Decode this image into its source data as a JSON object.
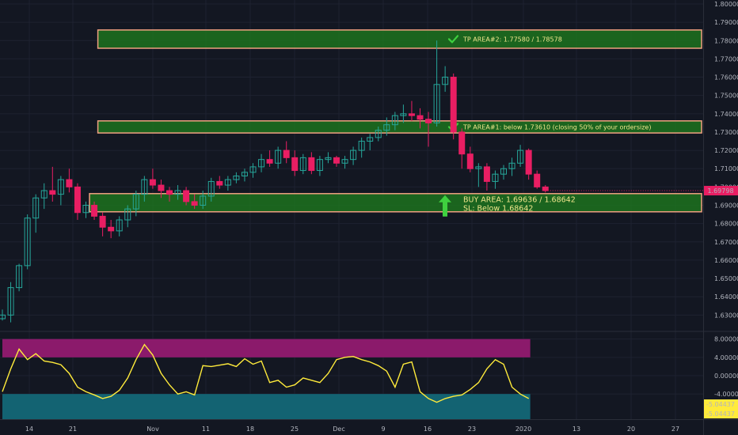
{
  "colors": {
    "background": "#131722",
    "grid": "#1e2230",
    "up": "#26a69a",
    "down": "#e91e63",
    "zone_fill": "#1e7a1e",
    "zone_border": "#f0a080",
    "osc_line": "#ffeb3b",
    "osc_upper_band": "#8b1a6b",
    "osc_lower_band": "#136372",
    "price_badge": "#e91e63",
    "label_text": "#f0e68c",
    "axis_text": "#b2b5be",
    "checkmark": "#3fd13f"
  },
  "icons": {
    "tp_check": "check-mark-icon",
    "buy_arrow": "arrow-up-icon"
  },
  "chart_data": [
    {
      "type": "candlestick",
      "x_ticks": [
        "14",
        "21",
        "Nov",
        "11",
        "18",
        "25",
        "Dec",
        "9",
        "16",
        "23",
        "2020",
        "13",
        "20",
        "27"
      ],
      "y_ticks": [
        "1.80000",
        "1.79000",
        "1.78000",
        "1.77000",
        "1.76000",
        "1.75000",
        "1.74000",
        "1.73000",
        "1.72000",
        "1.71000",
        "1.70000",
        "1.69000",
        "1.68000",
        "1.67000",
        "1.66000",
        "1.65000",
        "1.64000",
        "1.63000"
      ],
      "ylim": [
        1.6215,
        1.8
      ],
      "last_price": "1.69798",
      "candles": [
        [
          1.628,
          1.633,
          1.627,
          1.63
        ],
        [
          1.63,
          1.648,
          1.626,
          1.645
        ],
        [
          1.645,
          1.658,
          1.643,
          1.657
        ],
        [
          1.657,
          1.685,
          1.655,
          1.683
        ],
        [
          1.683,
          1.696,
          1.675,
          1.694
        ],
        [
          1.694,
          1.702,
          1.688,
          1.698
        ],
        [
          1.698,
          1.711,
          1.692,
          1.696
        ],
        [
          1.696,
          1.706,
          1.69,
          1.704
        ],
        [
          1.704,
          1.71,
          1.697,
          1.7
        ],
        [
          1.7,
          1.702,
          1.682,
          1.686
        ],
        [
          1.686,
          1.692,
          1.683,
          1.69
        ],
        [
          1.69,
          1.692,
          1.682,
          1.684
        ],
        [
          1.684,
          1.686,
          1.673,
          1.678
        ],
        [
          1.678,
          1.682,
          1.672,
          1.676
        ],
        [
          1.676,
          1.684,
          1.673,
          1.682
        ],
        [
          1.682,
          1.69,
          1.678,
          1.688
        ],
        [
          1.688,
          1.698,
          1.684,
          1.696
        ],
        [
          1.696,
          1.706,
          1.692,
          1.704
        ],
        [
          1.704,
          1.71,
          1.699,
          1.701
        ],
        [
          1.701,
          1.704,
          1.694,
          1.698
        ],
        [
          1.698,
          1.7,
          1.692,
          1.696
        ],
        [
          1.696,
          1.701,
          1.693,
          1.698
        ],
        [
          1.698,
          1.7,
          1.69,
          1.692
        ],
        [
          1.692,
          1.696,
          1.688,
          1.69
        ],
        [
          1.69,
          1.698,
          1.688,
          1.695
        ],
        [
          1.695,
          1.705,
          1.692,
          1.703
        ],
        [
          1.703,
          1.706,
          1.699,
          1.701
        ],
        [
          1.701,
          1.706,
          1.698,
          1.704
        ],
        [
          1.704,
          1.708,
          1.702,
          1.706
        ],
        [
          1.706,
          1.71,
          1.703,
          1.708
        ],
        [
          1.708,
          1.713,
          1.705,
          1.711
        ],
        [
          1.711,
          1.718,
          1.708,
          1.715
        ],
        [
          1.715,
          1.72,
          1.711,
          1.713
        ],
        [
          1.713,
          1.722,
          1.71,
          1.72
        ],
        [
          1.72,
          1.725,
          1.713,
          1.716
        ],
        [
          1.716,
          1.72,
          1.706,
          1.709
        ],
        [
          1.709,
          1.718,
          1.707,
          1.716
        ],
        [
          1.716,
          1.719,
          1.707,
          1.709
        ],
        [
          1.709,
          1.717,
          1.706,
          1.715
        ],
        [
          1.715,
          1.719,
          1.713,
          1.716
        ],
        [
          1.716,
          1.717,
          1.711,
          1.713
        ],
        [
          1.713,
          1.717,
          1.71,
          1.715
        ],
        [
          1.715,
          1.722,
          1.712,
          1.72
        ],
        [
          1.72,
          1.727,
          1.716,
          1.725
        ],
        [
          1.725,
          1.729,
          1.72,
          1.727
        ],
        [
          1.727,
          1.733,
          1.725,
          1.731
        ],
        [
          1.731,
          1.738,
          1.728,
          1.734
        ],
        [
          1.734,
          1.741,
          1.731,
          1.739
        ],
        [
          1.739,
          1.745,
          1.735,
          1.74
        ],
        [
          1.74,
          1.747,
          1.736,
          1.739
        ],
        [
          1.739,
          1.743,
          1.732,
          1.737
        ],
        [
          1.737,
          1.741,
          1.722,
          1.735
        ],
        [
          1.735,
          1.78,
          1.733,
          1.756
        ],
        [
          1.756,
          1.766,
          1.752,
          1.76
        ],
        [
          1.76,
          1.762,
          1.726,
          1.73
        ],
        [
          1.73,
          1.732,
          1.71,
          1.718
        ],
        [
          1.718,
          1.722,
          1.708,
          1.71
        ],
        [
          1.71,
          1.713,
          1.7,
          1.711
        ],
        [
          1.711,
          1.713,
          1.698,
          1.703
        ],
        [
          1.703,
          1.709,
          1.699,
          1.707
        ],
        [
          1.707,
          1.712,
          1.704,
          1.71
        ],
        [
          1.71,
          1.716,
          1.706,
          1.713
        ],
        [
          1.713,
          1.723,
          1.711,
          1.72
        ],
        [
          1.72,
          1.721,
          1.704,
          1.707
        ],
        [
          1.707,
          1.709,
          1.699,
          1.7
        ],
        [
          1.7,
          1.701,
          1.697,
          1.698
        ]
      ],
      "zones": [
        {
          "id": "tp2",
          "low": 1.7758,
          "high": 1.78578,
          "text": "TP AREA#2: 1.77580 / 1.78578",
          "start_index": 12
        },
        {
          "id": "tp1",
          "low": 1.7295,
          "high": 1.7361,
          "text": "TP AREA#1: below 1.73610 (closing 50% of your ordersize)",
          "start_index": 12
        },
        {
          "id": "buy",
          "low": 1.68642,
          "high": 1.69636,
          "text_line1": "BUY AREA: 1.69636 / 1.68642",
          "text_line2": "SL: Below 1.68642",
          "start_index": 11
        }
      ]
    },
    {
      "type": "line",
      "y_ticks": [
        "8.00000",
        "4.00000",
        "0.00000",
        "-4.00000"
      ],
      "ylim": [
        -9.5,
        9.5
      ],
      "bands": {
        "upper": [
          4.0,
          8.0
        ],
        "lower": [
          -9.5,
          -4.0
        ]
      },
      "last_value_labels": [
        "-5.04437",
        "-5.04437"
      ],
      "values": [
        -3.5,
        1.5,
        5.8,
        3.5,
        4.8,
        3.2,
        2.9,
        2.4,
        0.5,
        -2.5,
        -3.5,
        -4.2,
        -5.0,
        -4.5,
        -3.2,
        -0.5,
        3.5,
        6.8,
        4.5,
        0.5,
        -2.0,
        -4.0,
        -3.5,
        -4.2,
        2.2,
        2.0,
        2.3,
        2.6,
        2.0,
        3.7,
        2.5,
        3.2,
        -1.5,
        -1.0,
        -2.5,
        -2.0,
        -0.5,
        -1.0,
        -1.5,
        0.5,
        3.5,
        4.0,
        4.2,
        3.5,
        3.0,
        2.2,
        1.0,
        -2.5,
        2.5,
        3.0,
        -3.5,
        -5.0,
        -5.8,
        -5.0,
        -4.5,
        -4.2,
        -3.0,
        -1.5,
        1.5,
        3.5,
        2.5,
        -2.5,
        -4.0,
        -5.0
      ]
    }
  ]
}
